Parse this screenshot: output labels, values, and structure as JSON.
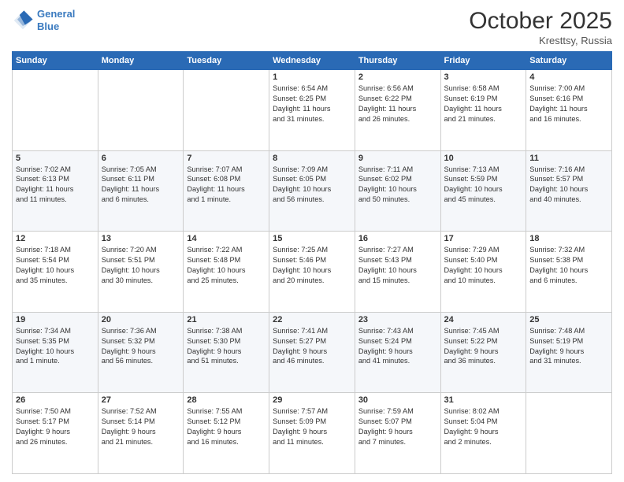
{
  "header": {
    "logo_line1": "General",
    "logo_line2": "Blue",
    "month": "October 2025",
    "location": "Kresttsy, Russia"
  },
  "weekdays": [
    "Sunday",
    "Monday",
    "Tuesday",
    "Wednesday",
    "Thursday",
    "Friday",
    "Saturday"
  ],
  "weeks": [
    [
      {
        "day": "",
        "info": ""
      },
      {
        "day": "",
        "info": ""
      },
      {
        "day": "",
        "info": ""
      },
      {
        "day": "1",
        "info": "Sunrise: 6:54 AM\nSunset: 6:25 PM\nDaylight: 11 hours\nand 31 minutes."
      },
      {
        "day": "2",
        "info": "Sunrise: 6:56 AM\nSunset: 6:22 PM\nDaylight: 11 hours\nand 26 minutes."
      },
      {
        "day": "3",
        "info": "Sunrise: 6:58 AM\nSunset: 6:19 PM\nDaylight: 11 hours\nand 21 minutes."
      },
      {
        "day": "4",
        "info": "Sunrise: 7:00 AM\nSunset: 6:16 PM\nDaylight: 11 hours\nand 16 minutes."
      }
    ],
    [
      {
        "day": "5",
        "info": "Sunrise: 7:02 AM\nSunset: 6:13 PM\nDaylight: 11 hours\nand 11 minutes."
      },
      {
        "day": "6",
        "info": "Sunrise: 7:05 AM\nSunset: 6:11 PM\nDaylight: 11 hours\nand 6 minutes."
      },
      {
        "day": "7",
        "info": "Sunrise: 7:07 AM\nSunset: 6:08 PM\nDaylight: 11 hours\nand 1 minute."
      },
      {
        "day": "8",
        "info": "Sunrise: 7:09 AM\nSunset: 6:05 PM\nDaylight: 10 hours\nand 56 minutes."
      },
      {
        "day": "9",
        "info": "Sunrise: 7:11 AM\nSunset: 6:02 PM\nDaylight: 10 hours\nand 50 minutes."
      },
      {
        "day": "10",
        "info": "Sunrise: 7:13 AM\nSunset: 5:59 PM\nDaylight: 10 hours\nand 45 minutes."
      },
      {
        "day": "11",
        "info": "Sunrise: 7:16 AM\nSunset: 5:57 PM\nDaylight: 10 hours\nand 40 minutes."
      }
    ],
    [
      {
        "day": "12",
        "info": "Sunrise: 7:18 AM\nSunset: 5:54 PM\nDaylight: 10 hours\nand 35 minutes."
      },
      {
        "day": "13",
        "info": "Sunrise: 7:20 AM\nSunset: 5:51 PM\nDaylight: 10 hours\nand 30 minutes."
      },
      {
        "day": "14",
        "info": "Sunrise: 7:22 AM\nSunset: 5:48 PM\nDaylight: 10 hours\nand 25 minutes."
      },
      {
        "day": "15",
        "info": "Sunrise: 7:25 AM\nSunset: 5:46 PM\nDaylight: 10 hours\nand 20 minutes."
      },
      {
        "day": "16",
        "info": "Sunrise: 7:27 AM\nSunset: 5:43 PM\nDaylight: 10 hours\nand 15 minutes."
      },
      {
        "day": "17",
        "info": "Sunrise: 7:29 AM\nSunset: 5:40 PM\nDaylight: 10 hours\nand 10 minutes."
      },
      {
        "day": "18",
        "info": "Sunrise: 7:32 AM\nSunset: 5:38 PM\nDaylight: 10 hours\nand 6 minutes."
      }
    ],
    [
      {
        "day": "19",
        "info": "Sunrise: 7:34 AM\nSunset: 5:35 PM\nDaylight: 10 hours\nand 1 minute."
      },
      {
        "day": "20",
        "info": "Sunrise: 7:36 AM\nSunset: 5:32 PM\nDaylight: 9 hours\nand 56 minutes."
      },
      {
        "day": "21",
        "info": "Sunrise: 7:38 AM\nSunset: 5:30 PM\nDaylight: 9 hours\nand 51 minutes."
      },
      {
        "day": "22",
        "info": "Sunrise: 7:41 AM\nSunset: 5:27 PM\nDaylight: 9 hours\nand 46 minutes."
      },
      {
        "day": "23",
        "info": "Sunrise: 7:43 AM\nSunset: 5:24 PM\nDaylight: 9 hours\nand 41 minutes."
      },
      {
        "day": "24",
        "info": "Sunrise: 7:45 AM\nSunset: 5:22 PM\nDaylight: 9 hours\nand 36 minutes."
      },
      {
        "day": "25",
        "info": "Sunrise: 7:48 AM\nSunset: 5:19 PM\nDaylight: 9 hours\nand 31 minutes."
      }
    ],
    [
      {
        "day": "26",
        "info": "Sunrise: 7:50 AM\nSunset: 5:17 PM\nDaylight: 9 hours\nand 26 minutes."
      },
      {
        "day": "27",
        "info": "Sunrise: 7:52 AM\nSunset: 5:14 PM\nDaylight: 9 hours\nand 21 minutes."
      },
      {
        "day": "28",
        "info": "Sunrise: 7:55 AM\nSunset: 5:12 PM\nDaylight: 9 hours\nand 16 minutes."
      },
      {
        "day": "29",
        "info": "Sunrise: 7:57 AM\nSunset: 5:09 PM\nDaylight: 9 hours\nand 11 minutes."
      },
      {
        "day": "30",
        "info": "Sunrise: 7:59 AM\nSunset: 5:07 PM\nDaylight: 9 hours\nand 7 minutes."
      },
      {
        "day": "31",
        "info": "Sunrise: 8:02 AM\nSunset: 5:04 PM\nDaylight: 9 hours\nand 2 minutes."
      },
      {
        "day": "",
        "info": ""
      }
    ]
  ]
}
